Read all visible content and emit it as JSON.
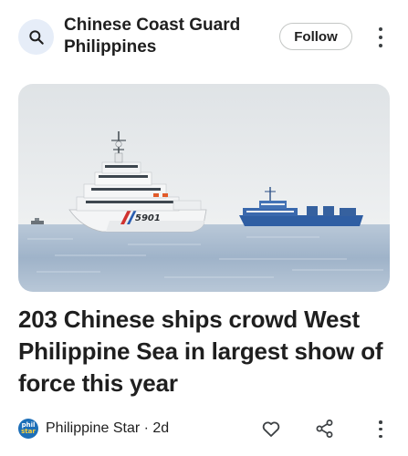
{
  "topic": {
    "title": "Chinese Coast Guard Philippines",
    "icon": "search-icon",
    "follow_label": "Follow",
    "menu_icon": "more-vert-icon"
  },
  "article": {
    "headline": "203 Chinese ships crowd West Philippine Sea in largest show of force this year",
    "image": {
      "ship_hull_number": "5901"
    }
  },
  "source": {
    "logo_line1": "phil",
    "logo_line2": "star",
    "meta": "Philippine Star · 2d",
    "like_icon": "heart-outline-icon",
    "share_icon": "share-icon",
    "menu_icon": "more-vert-icon"
  },
  "colors": {
    "text": "#1f1f1f",
    "icon_bg": "#e6edf8",
    "button_border": "#c4c7c5",
    "source_logo": "#1d6fb8"
  }
}
